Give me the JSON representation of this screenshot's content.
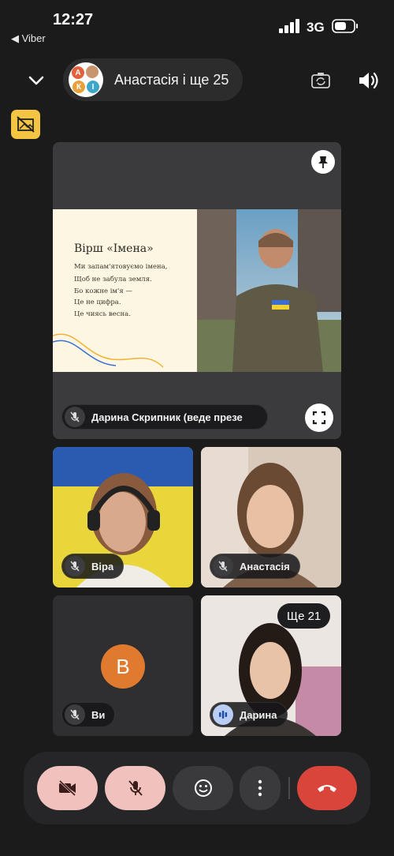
{
  "status_bar": {
    "time": "12:27",
    "back_app": "◀ Viber",
    "network": "3G"
  },
  "header": {
    "title": "Анастасія і ще 25",
    "avatar_letters": [
      "А",
      "К",
      "І"
    ]
  },
  "presentation": {
    "slide_title": "Вірш «Імена»",
    "slide_lines": [
      "Ми запам'ятовуємо імена,",
      "Щоб не забула земля.",
      "Бо кожне ім'я —",
      "Це не цифра.",
      "Це чиясь весна."
    ],
    "presenter_label": "Дарина Скрипник (веде презе"
  },
  "participants": {
    "vira": "Віра",
    "anastasia": "Анастасія",
    "you": "Ви",
    "you_avatar_letter": "В",
    "daryna": "Дарина",
    "more_count": "Ще 21"
  },
  "colors": {
    "end_call": "#d9453a",
    "muted_button": "#f0c1bd",
    "avatar_you": "#e07a2f",
    "badge": "#f4c542"
  }
}
